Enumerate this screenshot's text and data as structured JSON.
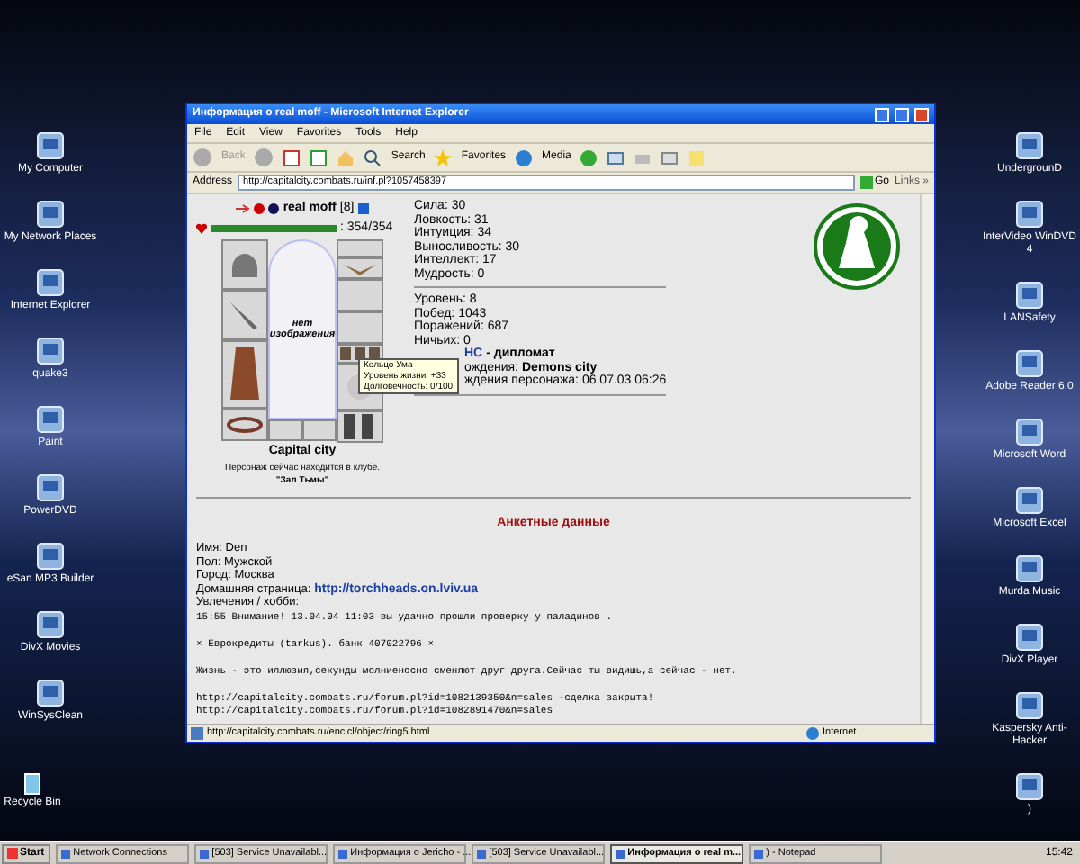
{
  "desktop": {
    "left_icons": [
      {
        "label": "My Computer"
      },
      {
        "label": "My Network Places"
      },
      {
        "label": "Internet Explorer"
      },
      {
        "label": "quake3"
      },
      {
        "label": "Paint"
      },
      {
        "label": "PowerDVD"
      },
      {
        "label": "eSan MP3 Builder"
      },
      {
        "label": "DivX Movies"
      },
      {
        "label": "WinSysClean"
      }
    ],
    "recycle_bin": "Recycle Bin",
    "right_icons": [
      {
        "label": "UndergrounD"
      },
      {
        "label": "InterVideo WinDVD 4"
      },
      {
        "label": "LANSafety"
      },
      {
        "label": "Adobe Reader 6.0"
      },
      {
        "label": "Microsoft Word"
      },
      {
        "label": "Microsoft Excel"
      },
      {
        "label": "Murda Music"
      },
      {
        "label": "DivX Player"
      },
      {
        "label": "Kaspersky Anti-Hacker"
      },
      {
        "label": ")"
      }
    ]
  },
  "window": {
    "title": "Информация о real moff - Microsoft Internet Explorer"
  },
  "menu": [
    "File",
    "Edit",
    "View",
    "Favorites",
    "Tools",
    "Help"
  ],
  "toolbar": {
    "back": "Back",
    "search": "Search",
    "favorites": "Favorites",
    "media": "Media"
  },
  "address": {
    "label": "Address",
    "url": "http://capitalcity.combats.ru/inf.pl?1057458397",
    "go": "Go",
    "links": "Links »"
  },
  "character": {
    "name": "real moff",
    "rank": "[8]",
    "health": {
      "level": 1,
      "reading": ": 354/354"
    },
    "no_image": "нет изображения",
    "city": "Capital city",
    "location": "Персонаж сейчас находится в клубе.",
    "room": "\"Зал Тьмы\""
  },
  "tooltip": [
    "Кольцо Ума",
    "Уровень жизни: +33",
    "Долговечность: 0/100"
  ],
  "stats": [
    "Сила: 30",
    "Ловкость: 31",
    "Интуиция: 34",
    "Выносливость: 30",
    "Интеллект: 17",
    "Мудрость: 0"
  ],
  "record": [
    "Уровень: 8",
    "Побед: 1043",
    "Поражений: 687",
    "Ничьих: 0"
  ],
  "clan": {
    "name": "НС",
    "role": "- дипломат"
  },
  "birthplace": {
    "label": "ождения:",
    "value": "Demons city"
  },
  "birth_date": "ждения персонажа: 06.07.03 06:26",
  "profile": {
    "heading": "Анкетные данные",
    "fields": [
      "Имя: Den",
      "Пол: Мужской",
      "Город: Москва"
    ],
    "homepage": {
      "label": "Домашняя страница:",
      "url": "http://torchheads.on.lviv.ua"
    },
    "hobby": "Увлечения / хобби:",
    "notes": [
      [
        "15:55 Внимание! 13.04.04 11:03 вы удачно прошли проверку у паладинов ."
      ],
      [
        "× Еврокредиты (tarkus). банк 407022796 ×"
      ],
      [
        "Жизнь - это иллюзия,секунды молниеносно сменяют друг друга.Сейчас ты видишь,а сейчас - нет."
      ],
      [
        "http://capitalcity.combats.ru/forum.pl?id=1082139350&n=sales -сделка закрыта!",
        "http://capitalcity.combats.ru/forum.pl?id=1082891470&n=sales"
      ]
    ]
  },
  "status_bar": {
    "url": "http://capitalcity.combats.ru/encicl/object/ring5.html",
    "zone": "Internet"
  },
  "taskbar": {
    "start": "Start",
    "tasks": [
      {
        "label": "Network Connections",
        "selected": false
      },
      {
        "label": "[503] Service Unavailabl...",
        "selected": false
      },
      {
        "label": "Информация о Jericho - ...",
        "selected": false
      },
      {
        "label": "[503] Service Unavailabl...",
        "selected": false
      },
      {
        "label": "Информация о real m...",
        "selected": true
      },
      {
        "label": ") - Notepad",
        "selected": false
      }
    ],
    "clock": "15:42"
  }
}
